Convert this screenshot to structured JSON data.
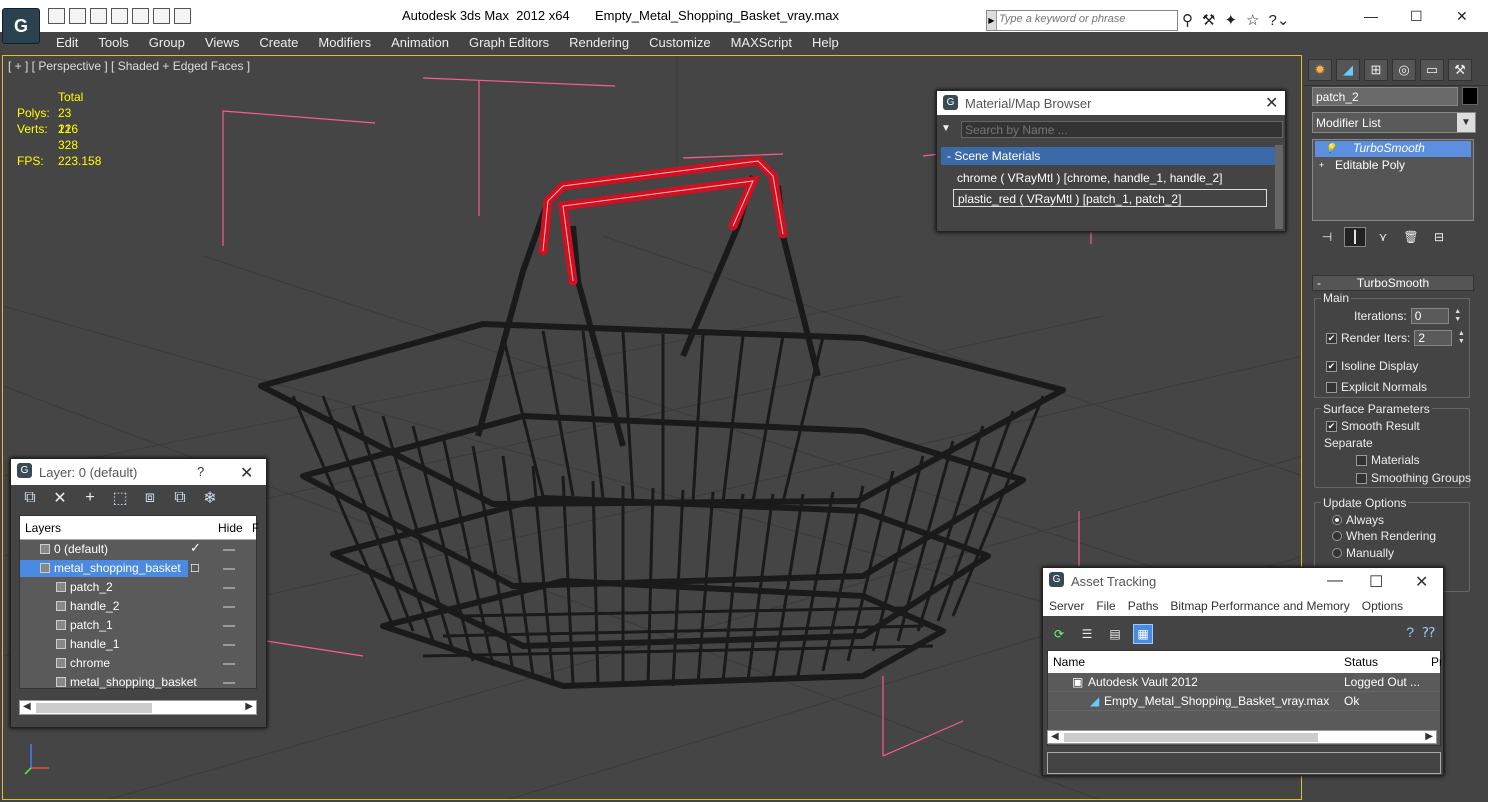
{
  "titlebar": {
    "app": "Autodesk 3ds Max  2012 x64",
    "file": "Empty_Metal_Shopping_Basket_vray.max",
    "search_placeholder": "Type a keyword or phrase",
    "icons": [
      "binoculars-icon",
      "tools-icon",
      "star-search-icon",
      "star-icon",
      "help-icon"
    ]
  },
  "menu": [
    "Edit",
    "Tools",
    "Group",
    "Views",
    "Create",
    "Modifiers",
    "Animation",
    "Graph Editors",
    "Rendering",
    "Customize",
    "MAXScript",
    "Help"
  ],
  "viewport": {
    "label": "[ + ] [ Perspective ] [ Shaded + Edged Faces ]",
    "stats": {
      "total_label": "Total",
      "polys_label": "Polys:",
      "polys_value": "23 216",
      "verts_label": "Verts:",
      "verts_value": "12 328",
      "fps_label": "FPS:",
      "fps_value": "223.158"
    },
    "accent_color": "#e0c030"
  },
  "command_panel": {
    "object_name": "patch_2",
    "modifier_list": "Modifier List",
    "stack": [
      "TurboSmooth",
      "Editable Poly"
    ],
    "rollout_title": "TurboSmooth",
    "main_label": "Main",
    "iterations_label": "Iterations:",
    "iterations_value": "0",
    "render_iters_label": "Render Iters:",
    "render_iters_value": "2",
    "isoline_label": "Isoline Display",
    "explicit_normals_label": "Explicit Normals",
    "surface_params_label": "Surface Parameters",
    "smooth_result_label": "Smooth Result",
    "separate_label": "Separate",
    "materials_label": "Materials",
    "smoothing_groups_label": "Smoothing Groups",
    "update_options_label": "Update Options",
    "always_label": "Always",
    "when_rendering_label": "When Rendering",
    "manually_label": "Manually"
  },
  "material_browser": {
    "title": "Material/Map Browser",
    "search_placeholder": "Search by Name ...",
    "category": "- Scene Materials",
    "items": [
      "chrome  ( VRayMtl )  [chrome, handle_1, handle_2]",
      "plastic_red  ( VRayMtl )  [patch_1, patch_2]"
    ]
  },
  "layer_manager": {
    "title": "Layer: 0 (default)",
    "help": "?",
    "col_layers": "Layers",
    "col_hide": "Hide",
    "col_f": "F",
    "rows": [
      "0 (default)",
      "metal_shopping_basket",
      "patch_2",
      "handle_2",
      "patch_1",
      "handle_1",
      "chrome",
      "metal_shopping_basket"
    ]
  },
  "asset_tracking": {
    "title": "Asset Tracking",
    "menu": [
      "Server",
      "File",
      "Paths",
      "Bitmap Performance and Memory",
      "Options"
    ],
    "col_name": "Name",
    "col_status": "Status",
    "col_p": "Pr",
    "rows": [
      {
        "name": "Autodesk Vault 2012",
        "status": "Logged Out ..."
      },
      {
        "name": "Empty_Metal_Shopping_Basket_vray.max",
        "status": "Ok"
      }
    ]
  }
}
